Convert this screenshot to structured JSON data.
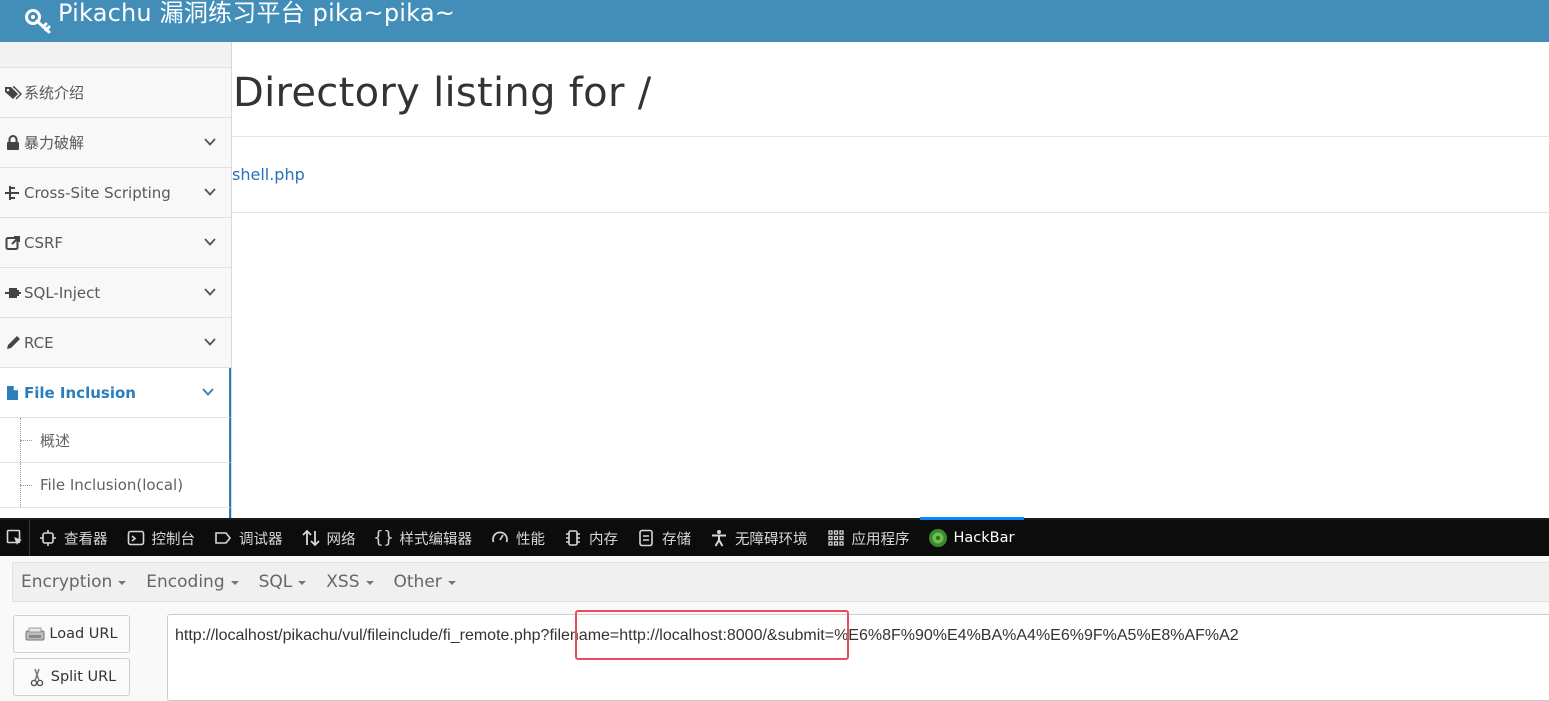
{
  "header": {
    "title": "Pikachu 漏洞练习平台 pika~pika~",
    "icon": "key-icon",
    "bg_color": "#438eb9"
  },
  "sidebar": {
    "items": [
      {
        "label": "系统介绍",
        "icon": "tags-icon",
        "expandable": false
      },
      {
        "label": "暴力破解",
        "icon": "lock-icon",
        "expandable": true
      },
      {
        "label": "Cross-Site Scripting",
        "icon": "sitemap-icon",
        "expandable": true
      },
      {
        "label": "CSRF",
        "icon": "share-icon",
        "expandable": true
      },
      {
        "label": "SQL-Inject",
        "icon": "plug-icon",
        "expandable": true
      },
      {
        "label": "RCE",
        "icon": "pencil-icon",
        "expandable": true
      },
      {
        "label": "File Inclusion",
        "icon": "file-icon",
        "expandable": true,
        "active": true
      }
    ],
    "subitems": [
      {
        "label": "概述"
      },
      {
        "label": "File Inclusion(local)"
      }
    ],
    "active_color": "#2b7dbc"
  },
  "main": {
    "heading": "Directory listing for /",
    "files": [
      "shell.php"
    ]
  },
  "devtools": {
    "tabs": [
      {
        "label": "查看器",
        "icon": "inspector-icon"
      },
      {
        "label": "控制台",
        "icon": "console-icon"
      },
      {
        "label": "调试器",
        "icon": "debugger-icon"
      },
      {
        "label": "网络",
        "icon": "network-icon"
      },
      {
        "label": "样式编辑器",
        "icon": "style-editor-icon"
      },
      {
        "label": "性能",
        "icon": "performance-icon"
      },
      {
        "label": "内存",
        "icon": "memory-icon"
      },
      {
        "label": "存储",
        "icon": "storage-icon"
      },
      {
        "label": "无障碍环境",
        "icon": "accessibility-icon"
      },
      {
        "label": "应用程序",
        "icon": "application-icon"
      },
      {
        "label": "HackBar",
        "icon": "hackbar-icon",
        "active": true
      }
    ]
  },
  "hackbar": {
    "menus": [
      "Encryption",
      "Encoding",
      "SQL",
      "XSS",
      "Other"
    ],
    "load_url_label": "Load URL",
    "split_url_label": "Split URL",
    "url_value": "http://localhost/pikachu/vul/fileinclude/fi_remote.php?filename=http://localhost:8000/&submit=%E6%8F%90%E4%BA%A4%E6%9F%A5%E8%AF%A2",
    "highlight_color": "#e94b5f"
  }
}
